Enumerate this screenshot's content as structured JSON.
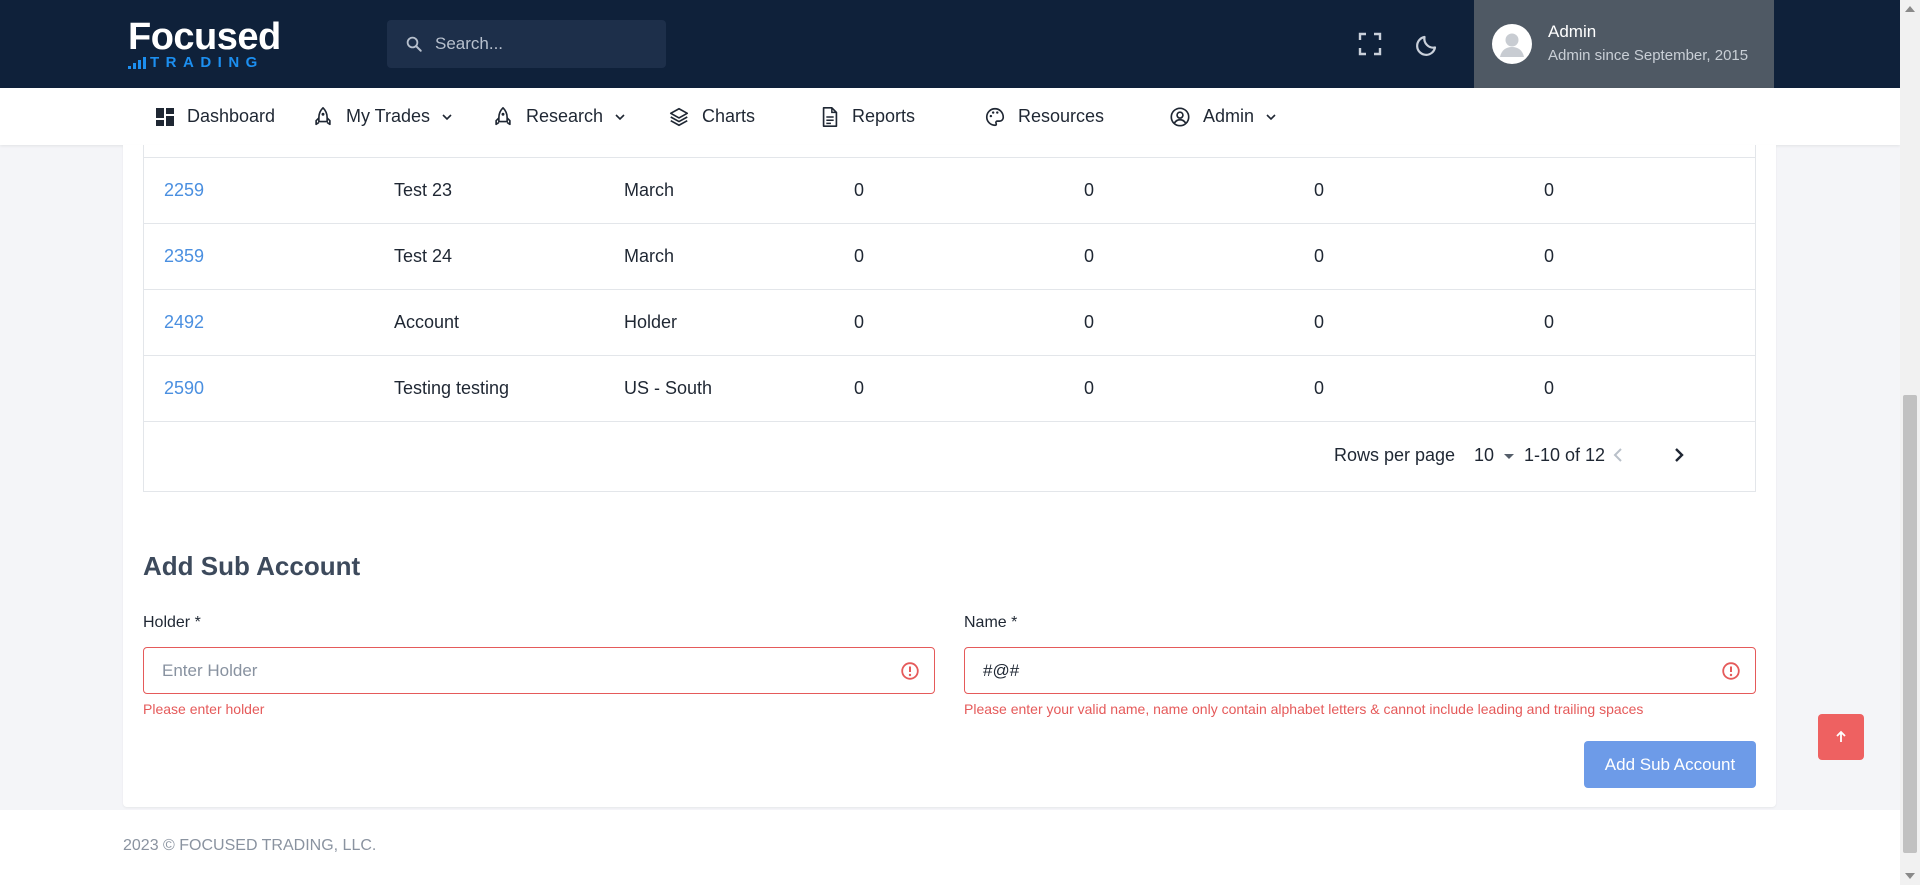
{
  "header": {
    "logo_top": "Focused",
    "logo_bottom": "TRADING",
    "search_placeholder": "Search...",
    "user": {
      "name": "Admin",
      "subtitle": "Admin since September, 2015"
    }
  },
  "nav": [
    {
      "label": "Dashboard",
      "icon": "dashboard-icon",
      "dropdown": false
    },
    {
      "label": "My Trades",
      "icon": "rocket-icon",
      "dropdown": true
    },
    {
      "label": "Research",
      "icon": "rocket-icon",
      "dropdown": true
    },
    {
      "label": "Charts",
      "icon": "layers-icon",
      "dropdown": false
    },
    {
      "label": "Reports",
      "icon": "document-icon",
      "dropdown": false
    },
    {
      "label": "Resources",
      "icon": "palette-icon",
      "dropdown": false
    },
    {
      "label": "Admin",
      "icon": "user-circle-icon",
      "dropdown": true
    }
  ],
  "table": {
    "rows": [
      {
        "id": "2259",
        "name": "Test 23",
        "holder": "March",
        "c1": "0",
        "c2": "0",
        "c3": "0",
        "c4": "0"
      },
      {
        "id": "2359",
        "name": "Test 24",
        "holder": "March",
        "c1": "0",
        "c2": "0",
        "c3": "0",
        "c4": "0"
      },
      {
        "id": "2492",
        "name": "Account",
        "holder": "Holder",
        "c1": "0",
        "c2": "0",
        "c3": "0",
        "c4": "0"
      },
      {
        "id": "2590",
        "name": "Testing testing",
        "holder": "US - South",
        "c1": "0",
        "c2": "0",
        "c3": "0",
        "c4": "0"
      }
    ],
    "pagination": {
      "rows_per_page_label": "Rows per page",
      "rows_per_page": "10",
      "range": "1-10 of 12"
    }
  },
  "form": {
    "title": "Add Sub Account",
    "holder": {
      "label": "Holder *",
      "placeholder": "Enter Holder",
      "value": "",
      "error": "Please enter holder"
    },
    "name": {
      "label": "Name *",
      "placeholder": "",
      "value": "#@#",
      "error": "Please enter your valid name, name only contain alphabet letters & cannot include leading and trailing spaces"
    },
    "submit_label": "Add Sub Account"
  },
  "footer": {
    "copyright": "2023 © FOCUSED TRADING, LLC."
  },
  "colors": {
    "header_bg": "#0f213a",
    "accent": "#1c8ff0",
    "link": "#4a8fe0",
    "error": "#e55a5a",
    "button": "#6d9be8",
    "scroll_top": "#ee6161"
  }
}
